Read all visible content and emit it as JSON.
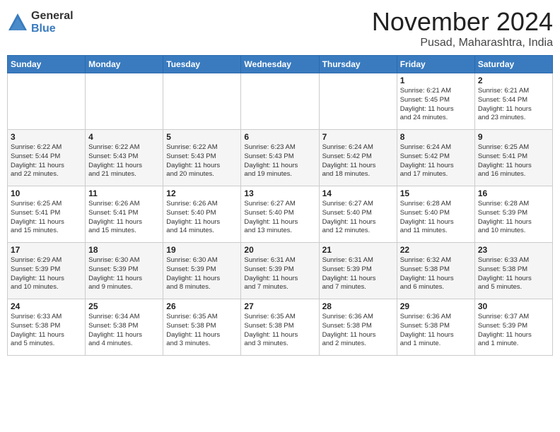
{
  "logo": {
    "general": "General",
    "blue": "Blue"
  },
  "title": "November 2024",
  "location": "Pusad, Maharashtra, India",
  "weekdays": [
    "Sunday",
    "Monday",
    "Tuesday",
    "Wednesday",
    "Thursday",
    "Friday",
    "Saturday"
  ],
  "days": [
    {
      "date": "",
      "info": ""
    },
    {
      "date": "",
      "info": ""
    },
    {
      "date": "",
      "info": ""
    },
    {
      "date": "",
      "info": ""
    },
    {
      "date": "",
      "info": ""
    },
    {
      "date": "1",
      "info": "Sunrise: 6:21 AM\nSunset: 5:45 PM\nDaylight: 11 hours\nand 24 minutes."
    },
    {
      "date": "2",
      "info": "Sunrise: 6:21 AM\nSunset: 5:44 PM\nDaylight: 11 hours\nand 23 minutes."
    },
    {
      "date": "3",
      "info": "Sunrise: 6:22 AM\nSunset: 5:44 PM\nDaylight: 11 hours\nand 22 minutes."
    },
    {
      "date": "4",
      "info": "Sunrise: 6:22 AM\nSunset: 5:43 PM\nDaylight: 11 hours\nand 21 minutes."
    },
    {
      "date": "5",
      "info": "Sunrise: 6:22 AM\nSunset: 5:43 PM\nDaylight: 11 hours\nand 20 minutes."
    },
    {
      "date": "6",
      "info": "Sunrise: 6:23 AM\nSunset: 5:43 PM\nDaylight: 11 hours\nand 19 minutes."
    },
    {
      "date": "7",
      "info": "Sunrise: 6:24 AM\nSunset: 5:42 PM\nDaylight: 11 hours\nand 18 minutes."
    },
    {
      "date": "8",
      "info": "Sunrise: 6:24 AM\nSunset: 5:42 PM\nDaylight: 11 hours\nand 17 minutes."
    },
    {
      "date": "9",
      "info": "Sunrise: 6:25 AM\nSunset: 5:41 PM\nDaylight: 11 hours\nand 16 minutes."
    },
    {
      "date": "10",
      "info": "Sunrise: 6:25 AM\nSunset: 5:41 PM\nDaylight: 11 hours\nand 15 minutes."
    },
    {
      "date": "11",
      "info": "Sunrise: 6:26 AM\nSunset: 5:41 PM\nDaylight: 11 hours\nand 15 minutes."
    },
    {
      "date": "12",
      "info": "Sunrise: 6:26 AM\nSunset: 5:40 PM\nDaylight: 11 hours\nand 14 minutes."
    },
    {
      "date": "13",
      "info": "Sunrise: 6:27 AM\nSunset: 5:40 PM\nDaylight: 11 hours\nand 13 minutes."
    },
    {
      "date": "14",
      "info": "Sunrise: 6:27 AM\nSunset: 5:40 PM\nDaylight: 11 hours\nand 12 minutes."
    },
    {
      "date": "15",
      "info": "Sunrise: 6:28 AM\nSunset: 5:40 PM\nDaylight: 11 hours\nand 11 minutes."
    },
    {
      "date": "16",
      "info": "Sunrise: 6:28 AM\nSunset: 5:39 PM\nDaylight: 11 hours\nand 10 minutes."
    },
    {
      "date": "17",
      "info": "Sunrise: 6:29 AM\nSunset: 5:39 PM\nDaylight: 11 hours\nand 10 minutes."
    },
    {
      "date": "18",
      "info": "Sunrise: 6:30 AM\nSunset: 5:39 PM\nDaylight: 11 hours\nand 9 minutes."
    },
    {
      "date": "19",
      "info": "Sunrise: 6:30 AM\nSunset: 5:39 PM\nDaylight: 11 hours\nand 8 minutes."
    },
    {
      "date": "20",
      "info": "Sunrise: 6:31 AM\nSunset: 5:39 PM\nDaylight: 11 hours\nand 7 minutes."
    },
    {
      "date": "21",
      "info": "Sunrise: 6:31 AM\nSunset: 5:39 PM\nDaylight: 11 hours\nand 7 minutes."
    },
    {
      "date": "22",
      "info": "Sunrise: 6:32 AM\nSunset: 5:38 PM\nDaylight: 11 hours\nand 6 minutes."
    },
    {
      "date": "23",
      "info": "Sunrise: 6:33 AM\nSunset: 5:38 PM\nDaylight: 11 hours\nand 5 minutes."
    },
    {
      "date": "24",
      "info": "Sunrise: 6:33 AM\nSunset: 5:38 PM\nDaylight: 11 hours\nand 5 minutes."
    },
    {
      "date": "25",
      "info": "Sunrise: 6:34 AM\nSunset: 5:38 PM\nDaylight: 11 hours\nand 4 minutes."
    },
    {
      "date": "26",
      "info": "Sunrise: 6:35 AM\nSunset: 5:38 PM\nDaylight: 11 hours\nand 3 minutes."
    },
    {
      "date": "27",
      "info": "Sunrise: 6:35 AM\nSunset: 5:38 PM\nDaylight: 11 hours\nand 3 minutes."
    },
    {
      "date": "28",
      "info": "Sunrise: 6:36 AM\nSunset: 5:38 PM\nDaylight: 11 hours\nand 2 minutes."
    },
    {
      "date": "29",
      "info": "Sunrise: 6:36 AM\nSunset: 5:38 PM\nDaylight: 11 hours\nand 1 minute."
    },
    {
      "date": "30",
      "info": "Sunrise: 6:37 AM\nSunset: 5:39 PM\nDaylight: 11 hours\nand 1 minute."
    }
  ]
}
